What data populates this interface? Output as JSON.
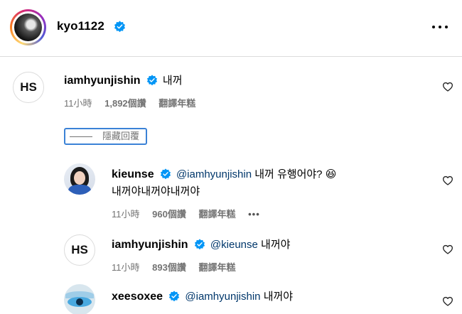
{
  "post_owner": {
    "username": "kyo1122",
    "verified": true
  },
  "comments": [
    {
      "username": "iamhyunjishin",
      "avatar_initials": "HS",
      "verified": true,
      "text": "내꺼",
      "time": "11小時",
      "views": "1,892個讚",
      "translate": "翻譯年糕"
    }
  ],
  "hide_replies_label": "隱藏回覆",
  "replies": [
    {
      "username": "kieunse",
      "verified": true,
      "mention": "@iamhyunjishin",
      "text": "내꺼 유행어야?",
      "emoji": "😆",
      "text_line2": "내꺼야내꺼야내꺼야",
      "time": "11小時",
      "views": "960個讚",
      "translate": "翻譯年糕",
      "more": "•••"
    },
    {
      "username": "iamhyunjishin",
      "avatar_initials": "HS",
      "verified": true,
      "mention": "@kieunse",
      "text": "내꺼야",
      "time": "11小時",
      "views": "893個讚",
      "translate": "翻譯年糕"
    },
    {
      "username": "xeesoxee",
      "verified": true,
      "mention": "@iamhyunjishin",
      "text": "내꺼야"
    }
  ],
  "colors": {
    "verified_badge": "#0095f6",
    "mention": "#00376b",
    "meta_text": "#737373",
    "focus_outline": "#3b82d6"
  },
  "icons": [
    "more-options-icon",
    "verified-badge-icon",
    "heart-icon"
  ]
}
